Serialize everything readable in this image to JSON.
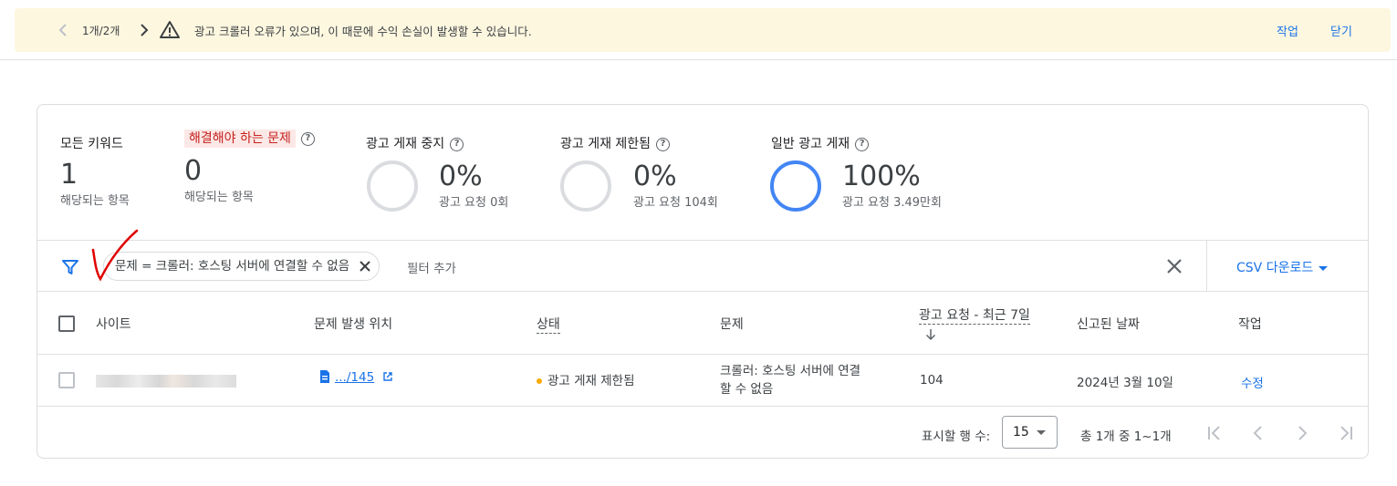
{
  "banner": {
    "pager": "1개/2개",
    "message": "광고 크롤러 오류가 있으며, 이 때문에 수익 손실이 발생할 수 있습니다.",
    "action_label": "작업",
    "close_label": "닫기"
  },
  "stats": {
    "all_keywords": {
      "label": "모든 키워드",
      "value": "1",
      "sub": "해당되는 항목"
    },
    "to_fix": {
      "label": "해결해야 하는 문제",
      "value": "0",
      "sub": "해당되는 항목"
    },
    "stopped": {
      "label": "광고 게재 중지",
      "value": "0%",
      "sub": "광고 요청 0회",
      "fraction": 0
    },
    "limited": {
      "label": "광고 게재 제한됨",
      "value": "0%",
      "sub": "광고 요청 104회",
      "fraction": 0
    },
    "normal": {
      "label": "일반 광고 게재",
      "value": "100%",
      "sub": "광고 요청 3.49만회",
      "fraction": 1
    }
  },
  "filter": {
    "chip_text": "문제 = 크롤러: 호스팅 서버에 연결할 수 없음",
    "add_filter": "필터 추가",
    "csv_label": "CSV 다운로드"
  },
  "table": {
    "headers": {
      "site": "사이트",
      "location": "문제 발생 위치",
      "status": "상태",
      "issue": "문제",
      "requests": "광고 요청 - 최근 7일",
      "reported": "신고된 날짜",
      "action": "작업"
    },
    "rows": [
      {
        "location": ".../145",
        "status": "광고 게재 제한됨",
        "issue_line1": "크롤러: 호스팅 서버에 연결",
        "issue_line2": "할 수 없음",
        "requests": "104",
        "reported": "2024년 3월 10일",
        "action": "수정"
      }
    ]
  },
  "footer": {
    "rows_label": "표시할 행 수:",
    "rows_value": "15",
    "range": "총 1개 중 1~1개"
  },
  "colors": {
    "accent": "#1a73e8",
    "banner_bg": "#fef7e0",
    "status_dot": "#f9ab00",
    "ring_full": "#4285f4",
    "ring_empty": "#dadce0",
    "annotation": "#e00000"
  }
}
